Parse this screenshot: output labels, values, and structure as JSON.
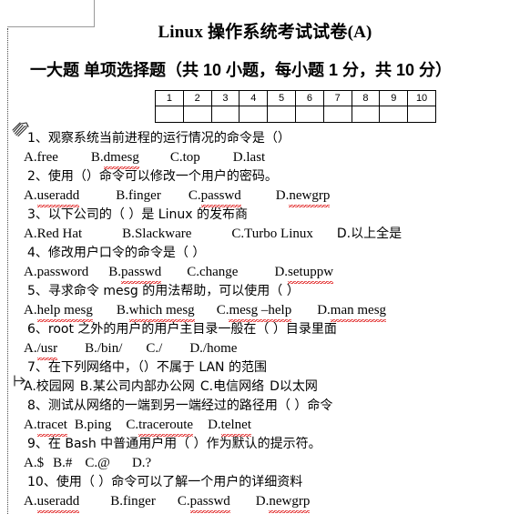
{
  "document": {
    "title": "Linux 操作系统考试试卷(A)",
    "section_heading": "一大题 单项选择题（共 10 小题，每小题 1 分，共 10 分）"
  },
  "answer_table": {
    "headers": [
      "1",
      "2",
      "3",
      "4",
      "5",
      "6",
      "7",
      "8",
      "9",
      "10"
    ],
    "answers": [
      "",
      "",
      "",
      "",
      "",
      "",
      "",
      "",
      "",
      ""
    ]
  },
  "questions": [
    {
      "number": "1",
      "stem": "1、观察系统当前进程的运行情况的命令是（）",
      "options_plain": "A.free　　B.dmesg　　C.top　　D.last",
      "options": [
        {
          "label": "A.",
          "text": "free",
          "misspelled": false
        },
        {
          "label": "B.",
          "text": "dmesg",
          "misspelled": true
        },
        {
          "label": "C.",
          "text": "top",
          "misspelled": false
        },
        {
          "label": "D.",
          "text": "last",
          "misspelled": false
        }
      ]
    },
    {
      "number": "2",
      "stem": "2、使用（）命令可以修改一个用户的密码。",
      "options_plain": "A.useradd　　B.finger　　C.passwd　　D.newgrp",
      "options": [
        {
          "label": "A.",
          "text": "useradd",
          "misspelled": true
        },
        {
          "label": "B.",
          "text": "finger",
          "misspelled": false
        },
        {
          "label": "C.",
          "text": "passwd",
          "misspelled": true
        },
        {
          "label": "D.",
          "text": "newgrp",
          "misspelled": true
        }
      ]
    },
    {
      "number": "3",
      "stem": "3、以下公司的（ ）是 Linux 的发布商",
      "options_plain": "A. Red  Hat　　B.Slackware　　C.Turbo Linux　　D. 以上全是",
      "options": [
        {
          "label": "A.",
          "text": "Red  Hat",
          "misspelled": false
        },
        {
          "label": "B.",
          "text": "Slackware",
          "misspelled": false
        },
        {
          "label": "C.",
          "text": "Turbo Linux",
          "misspelled": false
        },
        {
          "label": "D.",
          "text": "以上全是",
          "misspelled": false
        }
      ]
    },
    {
      "number": "4",
      "stem": "4、修改用户口令的命令是（ ）",
      "options_plain": "A.password　　B.passwd　　C.change　　D.setuppw",
      "options": [
        {
          "label": "A.",
          "text": "password",
          "misspelled": false
        },
        {
          "label": "B.",
          "text": "passwd",
          "misspelled": true
        },
        {
          "label": "C.",
          "text": "change",
          "misspelled": false
        },
        {
          "label": "D.",
          "text": "setuppw",
          "misspelled": true
        }
      ]
    },
    {
      "number": "5",
      "stem": "5、寻求命令 mesg 的用法帮助，可以使用（ ）",
      "options_plain": "A. help mesg　　B. which mesg　　C.mesg –help　　D. man mesg",
      "options": [
        {
          "label": "A.",
          "text": "help mesg",
          "misspelled": true
        },
        {
          "label": "B.",
          "text": "which mesg",
          "misspelled": true
        },
        {
          "label": "C.",
          "text": "mesg –help",
          "misspelled": true
        },
        {
          "label": "D.",
          "text": "man mesg",
          "misspelled": true
        }
      ]
    },
    {
      "number": "6",
      "stem": "6、root 之外的用户的用户主目录一般在（ ）目录里面",
      "options_plain": "A./usr　　B./bin/　　C./　　D./home",
      "options": [
        {
          "label": "A.",
          "text": "/usr",
          "misspelled": true
        },
        {
          "label": "B.",
          "text": "/bin/",
          "misspelled": false
        },
        {
          "label": "C.",
          "text": "/",
          "misspelled": false
        },
        {
          "label": "D.",
          "text": "/home",
          "misspelled": false
        }
      ]
    },
    {
      "number": "7",
      "stem": "7、在下列网络中，（）不属于 LAN 的范围",
      "options_plain": "A.校园网 B.某公司内部办公网 C.电信网络 D以太网",
      "options": [
        {
          "label": "A.",
          "text": "校园网",
          "misspelled": false
        },
        {
          "label": "B.",
          "text": "某公司内部办公网",
          "misspelled": false
        },
        {
          "label": "C.",
          "text": "电信网络",
          "misspelled": false
        },
        {
          "label": "D",
          "text": "以太网",
          "misspelled": false
        }
      ]
    },
    {
      "number": "8",
      "stem": "8、测试从网络的一端到另一端经过的路径用（ ）命令",
      "options_plain": "A.tracet　B. ping　　C. traceroute　　D.telnet",
      "options": [
        {
          "label": "A.",
          "text": "tracet",
          "misspelled": true
        },
        {
          "label": "B.",
          "text": "ping",
          "misspelled": false
        },
        {
          "label": "C.",
          "text": "traceroute",
          "misspelled": true
        },
        {
          "label": "D.",
          "text": "telnet",
          "misspelled": true
        }
      ]
    },
    {
      "number": "9",
      "stem": "9、在 Bash 中普通用户用（ ）作为默认的提示符。",
      "options_plain": "A. $  B. #　C. @　　D. ?",
      "options": [
        {
          "label": "A.",
          "text": "$",
          "misspelled": false
        },
        {
          "label": "B.",
          "text": "#",
          "misspelled": false
        },
        {
          "label": "C.",
          "text": "@",
          "misspelled": false
        },
        {
          "label": "D.",
          "text": "?",
          "misspelled": false
        }
      ]
    },
    {
      "number": "10",
      "stem": "10、使用（ ）命令可以了解一个用户的详细资料",
      "options_plain": "A.useradd　　B.finger　　C.passwd　　D.newgrp",
      "options": [
        {
          "label": "A.",
          "text": "useradd",
          "misspelled": true
        },
        {
          "label": "B.",
          "text": "finger",
          "misspelled": false
        },
        {
          "label": "C.",
          "text": "passwd",
          "misspelled": true
        },
        {
          "label": "D.",
          "text": "newgrp",
          "misspelled": true
        }
      ]
    }
  ],
  "annotations": [
    {
      "name": "margin-scribble",
      "kind": "handwritten-scribble"
    },
    {
      "name": "margin-arrow-mark",
      "kind": "handwritten-arrow"
    }
  ],
  "colors": {
    "text": "#000000",
    "spellcheck_underline": "#e02020",
    "margin_guide": "#9a9a9a",
    "table_border": "#000000"
  }
}
